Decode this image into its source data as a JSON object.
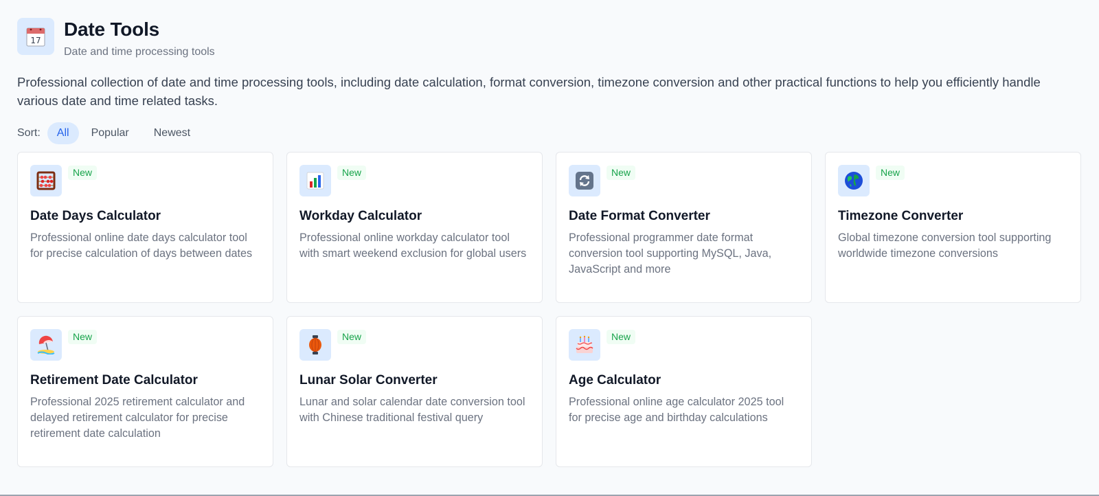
{
  "header": {
    "title": "Date Tools",
    "subtitle": "Date and time processing tools",
    "icon": "calendar-icon",
    "icon_text": "17"
  },
  "description": "Professional collection of date and time processing tools, including date calculation, format conversion, timezone conversion and other practical functions to help you efficiently handle various date and time related tasks.",
  "sort": {
    "label": "Sort:",
    "options": [
      "All",
      "Popular",
      "Newest"
    ],
    "selected": "All"
  },
  "colors": {
    "accent": "#2563eb",
    "accent_bg": "#dbeafe",
    "badge_green": "#16a34a",
    "badge_bg": "#f0fdf4"
  },
  "cards": [
    {
      "icon": "abacus-icon",
      "badge": "New",
      "title": "Date Days Calculator",
      "desc": "Professional online date days calculator tool for precise calculation of days between dates"
    },
    {
      "icon": "bar-chart-icon",
      "badge": "New",
      "title": "Workday Calculator",
      "desc": "Professional online workday calculator tool with smart weekend exclusion for global users"
    },
    {
      "icon": "refresh-icon",
      "badge": "New",
      "title": "Date Format Converter",
      "desc": "Professional programmer date format conversion tool supporting MySQL, Java, JavaScript and more"
    },
    {
      "icon": "globe-icon",
      "badge": "New",
      "title": "Timezone Converter",
      "desc": "Global timezone conversion tool supporting worldwide timezone conversions"
    },
    {
      "icon": "beach-umbrella-icon",
      "badge": "New",
      "title": "Retirement Date Calculator",
      "desc": "Professional 2025 retirement calculator and delayed retirement calculator for precise retirement date calculation"
    },
    {
      "icon": "lantern-icon",
      "badge": "New",
      "title": "Lunar Solar Converter",
      "desc": "Lunar and solar calendar date conversion tool with Chinese traditional festival query"
    },
    {
      "icon": "birthday-cake-icon",
      "badge": "New",
      "title": "Age Calculator",
      "desc": "Professional online age calculator 2025 tool for precise age and birthday calculations"
    }
  ]
}
